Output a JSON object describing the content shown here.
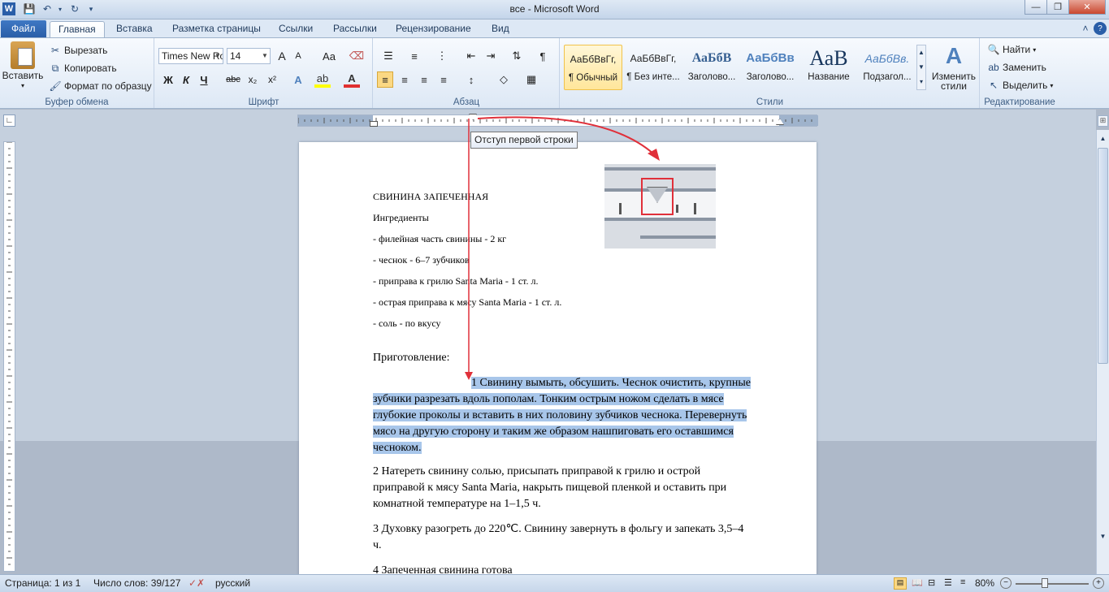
{
  "window": {
    "title": "все  -  Microsoft Word",
    "minimize": "—",
    "maximize": "❐",
    "close": "✕"
  },
  "tabs": [
    "Файл",
    "Главная",
    "Вставка",
    "Разметка страницы",
    "Ссылки",
    "Рассылки",
    "Рецензирование",
    "Вид"
  ],
  "clipboard": {
    "paste": "Вставить",
    "cut": "Вырезать",
    "copy": "Копировать",
    "format_painter": "Формат по образцу",
    "label": "Буфер обмена"
  },
  "font": {
    "name": "Times New Ro",
    "size": "14",
    "label": "Шрифт",
    "bold": "Ж",
    "italic": "К",
    "underline": "Ч",
    "strike": "abc",
    "subscript": "x₂",
    "superscript": "x²",
    "grow": "A",
    "shrink": "A",
    "case": "Aa"
  },
  "paragraph": {
    "label": "Абзац"
  },
  "styles": {
    "label": "Стили",
    "items": [
      {
        "preview": "АаБбВвГг,",
        "name": "¶ Обычный"
      },
      {
        "preview": "АаБбВвГг,",
        "name": "¶ Без инте..."
      },
      {
        "preview": "АаБбВ",
        "name": "Заголово..."
      },
      {
        "preview": "АаБбВв",
        "name": "Заголово..."
      },
      {
        "preview": "АаВ",
        "name": "Название"
      },
      {
        "preview": "АаБбВв.",
        "name": "Подзагол..."
      }
    ],
    "change": "Изменить стили"
  },
  "editing": {
    "label": "Редактирование",
    "find": "Найти",
    "replace": "Заменить",
    "select": "Выделить"
  },
  "tooltip": "Отступ первой строки",
  "document": {
    "title": "СВИНИНА ЗАПЕЧЕННАЯ",
    "ingredients_heading": "Ингредиенты",
    "ingredients": [
      "- филейная часть свинины - 2 кг",
      "- чеснок - 6–7 зубчиков",
      "- приправа к грилю Santa Maria - 1 ст. л.",
      "- острая приправа к мясу Santa Maria - 1 ст. л.",
      "- соль - по вкусу"
    ],
    "prep_heading": "Приготовление:",
    "step1": [
      "1 Свинину вымыть, обсушить. Чеснок очистить, крупные",
      "зубчики разрезать вдоль пополам. Тонким острым ножом сделать в мясе",
      "глубокие проколы и вставить в них половину зубчиков чеснока. Перевернуть",
      "мясо на другую сторону и таким же образом нашпиговать его оставшимся",
      "чесноком."
    ],
    "step2": [
      "2 Натереть свинину солью, присыпать приправой к грилю и острой",
      "приправой к мясу Santa Maria, накрыть пищевой пленкой и оставить при",
      "комнатной температуре на 1–1,5 ч."
    ],
    "step3": [
      "3 Духовку разогреть до 220℃. Свинину завернуть в фольгу и запекать 3,5–4",
      "ч."
    ],
    "step4": "4 Запеченная свинина готова"
  },
  "status": {
    "page": "Страница: 1 из 1",
    "words": "Число слов: 39/127",
    "language": "русский",
    "zoom": "80%"
  },
  "colors": {
    "accent": "#2a5ea8",
    "selection": "#a8c6ea",
    "annotation": "#e0303a"
  }
}
